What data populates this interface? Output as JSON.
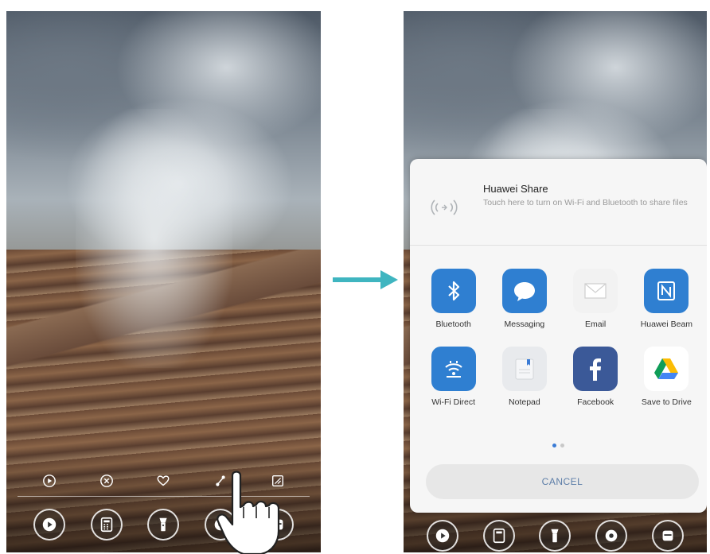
{
  "left_screen": {
    "edit_actions": [
      {
        "icon": "play-icon"
      },
      {
        "icon": "delete-icon"
      },
      {
        "icon": "favorite-icon"
      },
      {
        "icon": "share-icon"
      },
      {
        "icon": "edit-icon"
      }
    ],
    "dock_apps": [
      {
        "icon": "camera-app-icon"
      },
      {
        "icon": "calculator-app-icon"
      },
      {
        "icon": "flashlight-app-icon"
      },
      {
        "icon": "music-app-icon"
      },
      {
        "icon": "recorder-app-icon"
      }
    ]
  },
  "share_sheet": {
    "huawei_share": {
      "title": "Huawei Share",
      "description": "Touch here to turn on Wi-Fi and Bluetooth to share files"
    },
    "apps": [
      {
        "label": "Bluetooth",
        "icon": "bluetooth-icon",
        "color": "#2f7fd1"
      },
      {
        "label": "Messaging",
        "icon": "messaging-icon",
        "color": "#2f7fd1"
      },
      {
        "label": "Email",
        "icon": "email-icon",
        "color": "#f2f2f2"
      },
      {
        "label": "Huawei Beam",
        "icon": "nfc-icon",
        "color": "#2f7fd1"
      },
      {
        "label": "Wi-Fi Direct",
        "icon": "wifi-direct-icon",
        "color": "#2f7fd1"
      },
      {
        "label": "Notepad",
        "icon": "notepad-icon",
        "color": "#e8eaed"
      },
      {
        "label": "Facebook",
        "icon": "facebook-icon",
        "color": "#3b5998"
      },
      {
        "label": "Save to Drive",
        "icon": "google-drive-icon",
        "color": "#ffffff"
      }
    ],
    "page_count": 2,
    "active_page": 1,
    "cancel_label": "CANCEL"
  },
  "colors": {
    "arrow": "#3fb5c0",
    "accent": "#2f7fd1"
  }
}
